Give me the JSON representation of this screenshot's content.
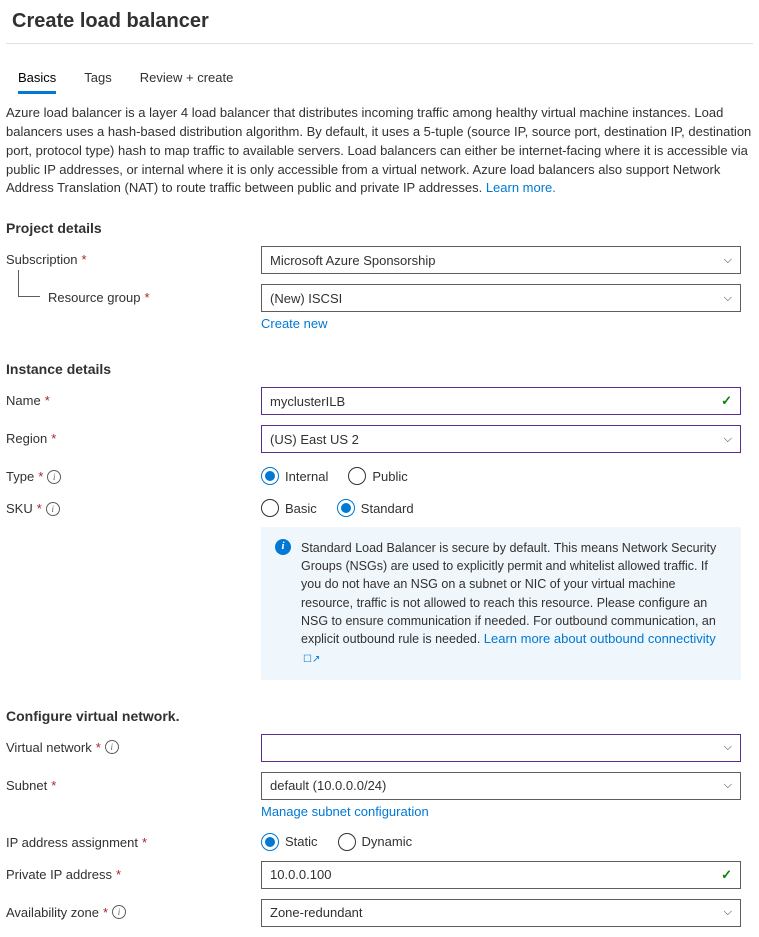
{
  "title": "Create load balancer",
  "tabs": {
    "basics": "Basics",
    "tags": "Tags",
    "review": "Review + create"
  },
  "description": "Azure load balancer is a layer 4 load balancer that distributes incoming traffic among healthy virtual machine instances. Load balancers uses a hash-based distribution algorithm. By default, it uses a 5-tuple (source IP, source port, destination IP, destination port, protocol type) hash to map traffic to available servers. Load balancers can either be internet-facing where it is accessible via public IP addresses, or internal where it is only accessible from a virtual network. Azure load balancers also support Network Address Translation (NAT) to route traffic between public and private IP addresses.  ",
  "learn_more": "Learn more.",
  "project": {
    "heading": "Project details",
    "subscription_label": "Subscription",
    "subscription_value": "Microsoft Azure Sponsorship",
    "rg_label": "Resource group",
    "rg_value": "(New) ISCSI",
    "create_new": "Create new"
  },
  "instance": {
    "heading": "Instance details",
    "name_label": "Name",
    "name_value": "myclusterILB",
    "region_label": "Region",
    "region_value": "(US) East US 2",
    "type_label": "Type",
    "type_opts": {
      "internal": "Internal",
      "public": "Public"
    },
    "sku_label": "SKU",
    "sku_opts": {
      "basic": "Basic",
      "standard": "Standard"
    }
  },
  "infobox": {
    "text": "Standard Load Balancer is secure by default.  This means Network Security Groups (NSGs) are used to explicitly permit and whitelist allowed traffic. If you do not have an NSG on a subnet or NIC of your virtual machine resource, traffic is not allowed to reach this resource. Please configure an NSG to ensure communication if needed.  For outbound communication, an explicit outbound rule is needed.  ",
    "link": "Learn more about outbound connectivity"
  },
  "vnet": {
    "heading": "Configure virtual network.",
    "vnet_label": "Virtual network",
    "vnet_value": "",
    "subnet_label": "Subnet",
    "subnet_value": "default (10.0.0.0/24)",
    "manage": "Manage subnet configuration",
    "ip_assign_label": "IP address assignment",
    "ip_opts": {
      "static": "Static",
      "dynamic": "Dynamic"
    },
    "private_ip_label": "Private IP address",
    "private_ip_value": "10.0.0.100",
    "az_label": "Availability zone",
    "az_value": "Zone-redundant"
  }
}
